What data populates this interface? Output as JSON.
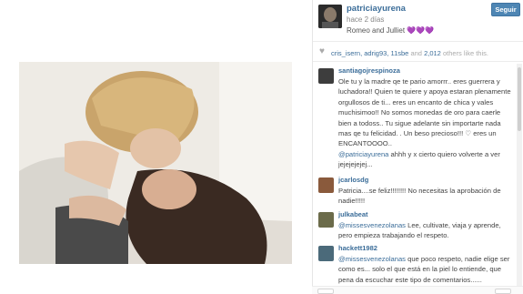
{
  "post": {
    "owner": "patriciayurena",
    "time_ago": "hace 2 días",
    "caption": "Romeo and Julliet 💜💜💜",
    "follow_label": "Seguir"
  },
  "likes": {
    "user1": "cris_isern",
    "user2": "adrig93",
    "user3": "11sbe",
    "and": "and",
    "count": "2,012",
    "suffix": "others like this."
  },
  "comments": [
    {
      "user": "santiagojrespinoza",
      "text": "Ole tu y la madre qe te pario amorrr.. eres guerrera y luchadora!! Quien te quiere y apoya estaran plenamente orgullosos de ti... eres un encanto de chica y vales muchisimoo!! No somos monedas de oro para caerle bien a todoss.. Tu sigue adelante sin importarte nada mas qe tu felicidad. . Un beso precioso!!! ♡ eres un ENCANTOOOO..",
      "mention": "@patriciayurena",
      "tail": "ahhh y x cierto quiero volverte a ver jejejejejej..."
    },
    {
      "user": "jcarlosdg",
      "text": "Patricia....se feliz!!!!!!!! No necesitas la aprobación de nadie!!!!!"
    },
    {
      "user": "julkabeat",
      "mention": "@missesvenezolanas",
      "text": "Lee, cultivate, viaja y aprende, pero empieza trabajando el respeto."
    },
    {
      "user": "hackett1982",
      "mention": "@missesvenezolanas",
      "text": "que poco respeto, nadie elige ser como es... solo el que está en la piel lo entiende, que pena da escuchar este tipo de comentarios......"
    }
  ],
  "icons": {
    "heart": "heart-icon",
    "owner_avatar": "avatar"
  },
  "colors": {
    "link": "#3b6d99",
    "follow_button": "#4e86b4"
  }
}
